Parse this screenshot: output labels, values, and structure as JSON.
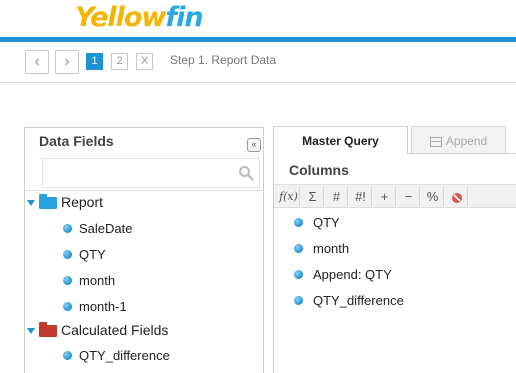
{
  "header": {
    "logo_part1": "Yellow",
    "logo_part2": "fin"
  },
  "stepbar": {
    "back_label": "‹",
    "forward_label": "›",
    "steps": [
      {
        "label": "1",
        "active": true
      },
      {
        "label": "2",
        "active": false
      },
      {
        "label": "X",
        "active": false
      }
    ],
    "step_label": "Step 1. Report Data"
  },
  "data_fields": {
    "title": "Data Fields",
    "collapse_label": "«",
    "search_value": "",
    "search_placeholder": "",
    "groups": [
      {
        "label": "Report",
        "folder_color": "#29a1e0",
        "items": [
          "SaleDate",
          "QTY",
          "month",
          "month-1"
        ]
      },
      {
        "label": "Calculated Fields",
        "folder_color": "#c0392b",
        "items": [
          "QTY_difference"
        ]
      }
    ]
  },
  "tabs": {
    "master_query": "Master Query",
    "append": "Append"
  },
  "columns": {
    "title": "Columns",
    "toolbar": [
      "f(x)",
      "Σ",
      "#",
      "#!",
      "+",
      "−",
      "%",
      "no-icon"
    ],
    "items": [
      "QTY",
      "month",
      "Append: QTY",
      "QTY_difference"
    ]
  },
  "colors": {
    "accent": "#1b93d4",
    "logo_yellow": "#f5b400",
    "logo_blue": "#29a9e1"
  }
}
